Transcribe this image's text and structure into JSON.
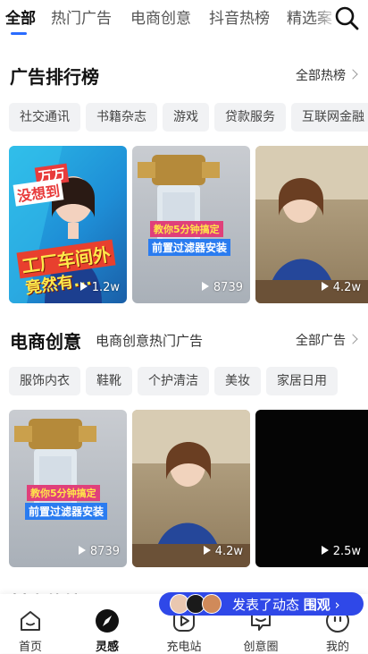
{
  "top_tabs": [
    {
      "label": "全部",
      "active": true
    },
    {
      "label": "热门广告",
      "active": false
    },
    {
      "label": "电商创意",
      "active": false
    },
    {
      "label": "抖音热榜",
      "active": false
    },
    {
      "label": "精选案",
      "active": false
    }
  ],
  "section_rank": {
    "title": "广告排行榜",
    "more_label": "全部热榜",
    "chips": [
      "社交通讯",
      "书籍杂志",
      "游戏",
      "贷款服务",
      "互联网金融"
    ],
    "videos": [
      {
        "views": "1.2w",
        "overlay_top": "万万",
        "overlay_mid": "没想到",
        "overlay_banner": "工厂车间外",
        "overlay_bottom": "竟然有..."
      },
      {
        "views": "8739",
        "overlay_top": "教你5分钟搞定",
        "overlay_banner": "前置过滤器安装"
      },
      {
        "views": "4.2w"
      }
    ]
  },
  "section_ecom": {
    "title": "电商创意",
    "subtitle": "电商创意热门广告",
    "more_label": "全部广告",
    "chips": [
      "服饰内衣",
      "鞋靴",
      "个护清洁",
      "美妆",
      "家居日用"
    ],
    "videos": [
      {
        "views": "8739",
        "overlay_top": "教你5分钟搞定",
        "overlay_banner": "前置过滤器安装"
      },
      {
        "views": "4.2w"
      },
      {
        "views": "2.5w"
      }
    ]
  },
  "next_section_title": "抖音热榜",
  "toast": {
    "text": "发表了动态",
    "action": "围观"
  },
  "bottom_nav": [
    {
      "label": "首页",
      "icon": "home-icon",
      "active": false
    },
    {
      "label": "灵感",
      "icon": "compass-icon",
      "active": true
    },
    {
      "label": "充电站",
      "icon": "play-icon",
      "active": false
    },
    {
      "label": "创意圈",
      "icon": "message-icon",
      "active": false
    },
    {
      "label": "我的",
      "icon": "profile-icon",
      "active": false
    }
  ],
  "colors": {
    "accent": "#2a6cff",
    "toast_bg": "#2f48e8",
    "chip_bg": "#f1f2f4"
  }
}
